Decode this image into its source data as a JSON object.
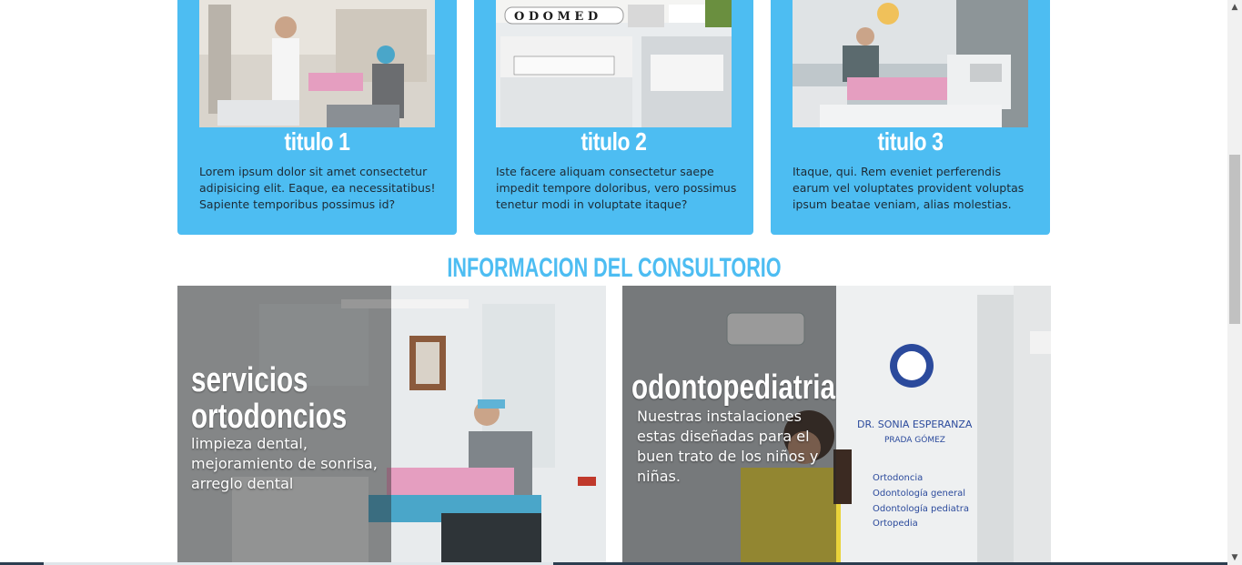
{
  "cards": [
    {
      "title": "titulo 1",
      "text": "Lorem ipsum dolor sit amet consectetur adipisicing elit. Eaque, ea necessitatibus! Sapiente temporibus possimus id?",
      "image": "dental-clinic-photo"
    },
    {
      "title": "titulo 2",
      "text": "Iste facere aliquam consectetur saepe impedit tempore doloribus, vero possimus tenetur modi in voluptate itaque?",
      "image": "building-facade-photo",
      "sign_text": "O D O M E D"
    },
    {
      "title": "titulo 3",
      "text": "Itaque, qui. Rem eveniet perferendis earum vel voluptates provident voluptas ipsum beatae veniam, alias molestias.",
      "image": "dental-chair-photo"
    }
  ],
  "section": {
    "title": "INFORMACION DEL CONSULTORIO"
  },
  "panels": [
    {
      "title_line1": "servicios",
      "title_line2": "ortodoncios",
      "text": "limpieza dental, mejoramiento de sonrisa, arreglo dental",
      "image": "orthodontics-photo"
    },
    {
      "title": "odontopediatria",
      "text": "Nuestras instalaciones estas diseñadas para el buen trato de los niños y niñas.",
      "image": "pediatric-office-photo",
      "door_sign": {
        "name_line1": "DR. SONIA ESPERANZA",
        "name_line2": "PRADA GÓMEZ",
        "services": [
          "Ortodoncia",
          "Odontología general",
          "Odontología pediatra",
          "Ortopedia"
        ]
      }
    }
  ],
  "colors": {
    "accent": "#4dbdf2",
    "card_text": "#1d2b36"
  },
  "scrollbar": {
    "up_icon": "arrow-up-icon",
    "down_icon": "arrow-down-icon"
  }
}
